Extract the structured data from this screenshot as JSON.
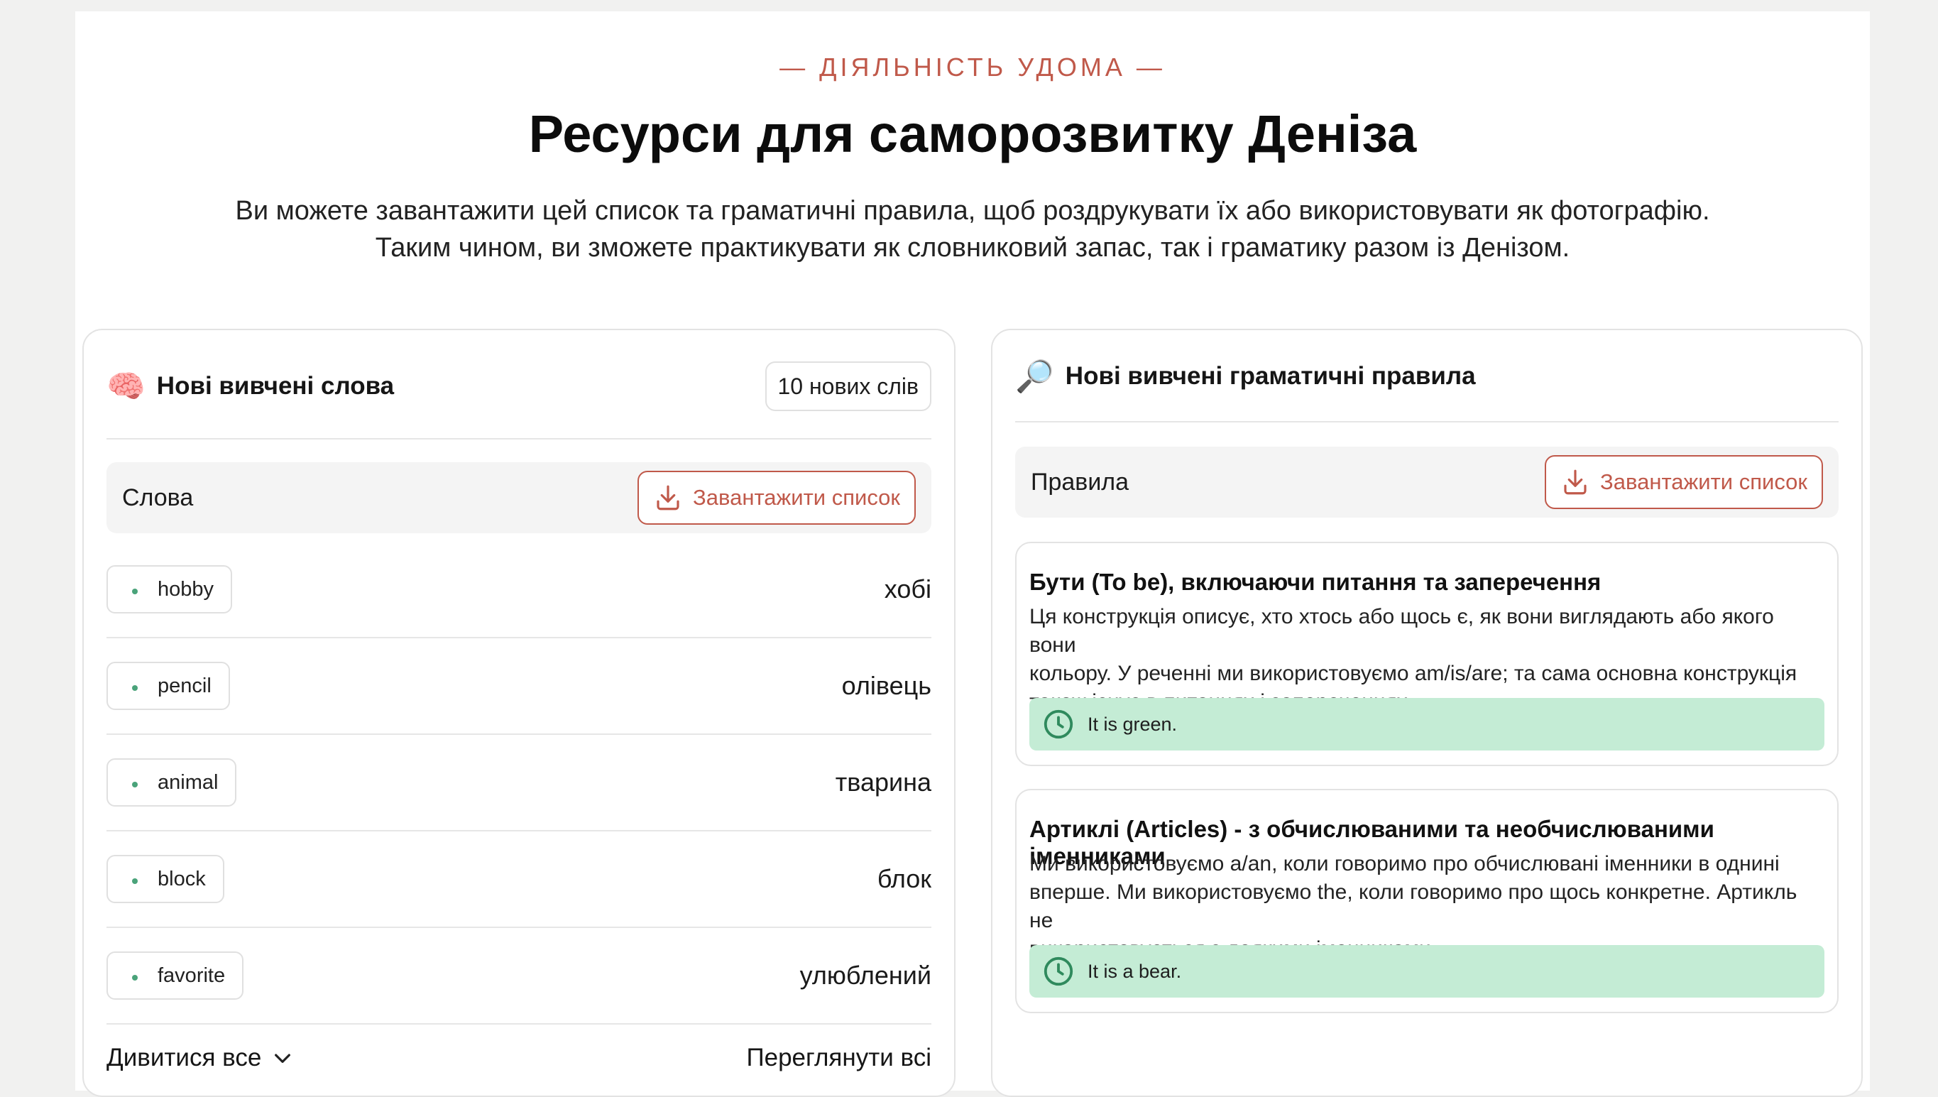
{
  "header": {
    "eyebrow": "— ДІЯЛЬНІСТЬ УДОМА —",
    "title": "Ресурси для саморозвитку Деніза",
    "subtitle_line1": "Ви можете завантажити цей список та граматичні правила, щоб роздрукувати їх або використовувати як фотографію.",
    "subtitle_line2": "Таким чином, ви зможете практикувати як словниковий запас, так і граматику разом із Денізом."
  },
  "words_card": {
    "emoji": "🧠",
    "title": "Нові вивчені слова",
    "count_badge": "10 нових слів",
    "section_label": "Слова",
    "download_label": "Завантажити список",
    "words": [
      {
        "en": "hobby",
        "uk": "хобі"
      },
      {
        "en": "pencil",
        "uk": "олівець"
      },
      {
        "en": "animal",
        "uk": "тварина"
      },
      {
        "en": "block",
        "uk": "блок"
      },
      {
        "en": "favorite",
        "uk": "улюблений"
      }
    ],
    "view_all": "Дивитися все",
    "browse_all": "Переглянути всі"
  },
  "grammar_card": {
    "emoji": "🔎",
    "title": "Нові вивчені граматичні правила",
    "section_label": "Правила",
    "download_label": "Завантажити список",
    "rules": [
      {
        "title": "Бути (To be), включаючи питання та заперечення",
        "desc_line1": "Ця конструкція описує, хто хтось або щось є, як вони виглядають або якого вони",
        "desc_line2": "кольору. У реченні ми використовуємо am/is/are; та сама основна конструкція",
        "desc_line3": "також існує в питаннях і запереченнях.",
        "example": "It is green."
      },
      {
        "title": "Артиклі (Articles) - з обчислюваними та необчислюваними іменниками",
        "desc_line1": "Ми використовуємо a/an, коли говоримо про обчислювані іменники в однині",
        "desc_line2": "вперше. Ми використовуємо the, коли говоримо про щось конкретне. Артикль не",
        "desc_line3": "використовується з деякими іменниками.",
        "example": "It is a bear."
      }
    ]
  },
  "colors": {
    "accent": "#c0594a",
    "example_bg": "#c4ecd5",
    "dot_green": "#4aa37a"
  },
  "icons": [
    "brain-icon",
    "magnifier-icon",
    "download-icon",
    "chevron-down-icon",
    "clock-icon"
  ]
}
